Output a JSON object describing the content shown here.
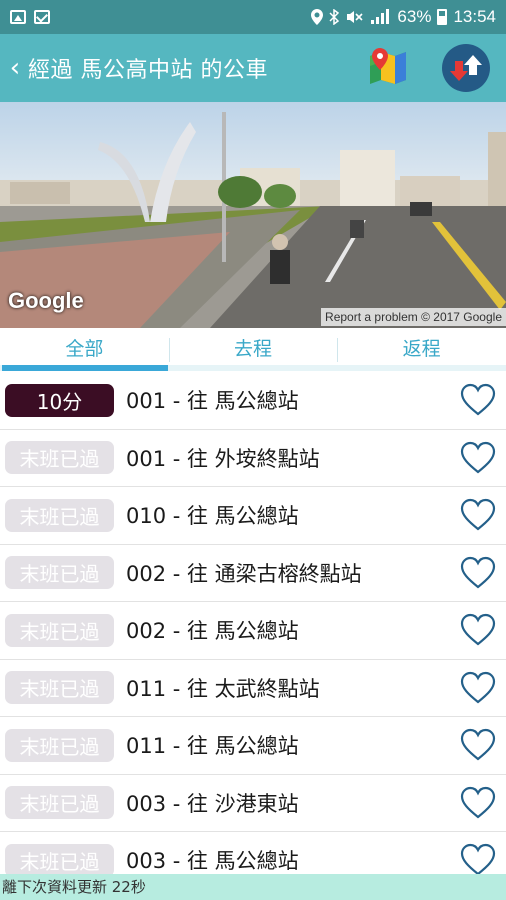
{
  "status_bar": {
    "battery": "63%",
    "time": "13:54",
    "icons": [
      "gallery-icon",
      "mail-icon",
      "location-icon",
      "bluetooth-icon",
      "mute-icon",
      "signal-icon",
      "battery-icon"
    ]
  },
  "app_bar": {
    "title": "經過 馬公高中站 的公車",
    "back_icon": "chevron-left-icon",
    "map_icon": "map-icon",
    "swap_icon": "swap-direction-icon",
    "color": "#55b7c0"
  },
  "street_view": {
    "logo": "Google",
    "report_text": "Report a problem  © 2017 Google"
  },
  "tabs": [
    {
      "label": "全部",
      "active": true
    },
    {
      "label": "去程",
      "active": false
    },
    {
      "label": "返程",
      "active": false
    }
  ],
  "buses": [
    {
      "eta": "10分",
      "state": "live",
      "route": "001 - 往 馬公總站"
    },
    {
      "eta": "末班已過",
      "state": "ended",
      "route": "001 - 往 外垵終點站"
    },
    {
      "eta": "末班已過",
      "state": "ended",
      "route": "010 - 往 馬公總站"
    },
    {
      "eta": "末班已過",
      "state": "ended",
      "route": "002 - 往 通梁古榕終點站"
    },
    {
      "eta": "末班已過",
      "state": "ended",
      "route": "002 - 往 馬公總站"
    },
    {
      "eta": "末班已過",
      "state": "ended",
      "route": "011 - 往 太武終點站"
    },
    {
      "eta": "末班已過",
      "state": "ended",
      "route": "011 - 往 馬公總站"
    },
    {
      "eta": "末班已過",
      "state": "ended",
      "route": "003 - 往 沙港東站"
    },
    {
      "eta": "末班已過",
      "state": "ended",
      "route": "003 - 往 馬公總站"
    }
  ],
  "footer": {
    "text": "離下次資料更新 22秒"
  }
}
